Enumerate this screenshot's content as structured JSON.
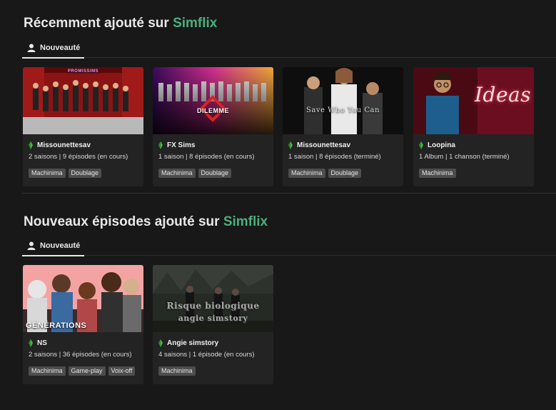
{
  "sections": [
    {
      "title_prefix": "Récemment ajouté sur ",
      "title_brand": "Simflix",
      "tab_label": "Nouveauté",
      "cards": [
        {
          "author": "Missounettesav",
          "meta": "2 saisons | 9 épisodes (en cours)",
          "tags": [
            "Machinima",
            "Doublage"
          ],
          "thumb_text": "PROMISSIMS"
        },
        {
          "author": "FX Sims",
          "meta": "1 saison | 8 épisodes (en cours)",
          "tags": [
            "Machinima",
            "Doublage"
          ],
          "thumb_text": "DILEMME"
        },
        {
          "author": "Missounettesav",
          "meta": "1 saison | 8 épisodes (terminé)",
          "tags": [
            "Machinima",
            "Doublage"
          ],
          "thumb_text": "Save Who You Can"
        },
        {
          "author": "Loopina",
          "meta": "1 Album | 1 chanson (terminé)",
          "tags": [
            "Machinima"
          ],
          "thumb_text": "Ideas"
        }
      ]
    },
    {
      "title_prefix": "Nouveaux épisodes ajouté sur ",
      "title_brand": "Simflix",
      "tab_label": "Nouveauté",
      "cards": [
        {
          "author": "NS",
          "meta": "2 saisons | 36 épisodes (en cours)",
          "tags": [
            "Machinima",
            "Game-play",
            "Voix-off"
          ],
          "thumb_text": "GÉNÉRATIONS"
        },
        {
          "author": "Angie simstory",
          "meta": "4 saisons | 1 épisode (en cours)",
          "tags": [
            "Machinima"
          ],
          "thumb_text_line1": "Risque biologique",
          "thumb_text_line2": "angie simstory"
        }
      ]
    }
  ],
  "colors": {
    "background": "#181818",
    "card": "#232323",
    "brand": "#4caf7d",
    "tag": "#4d4d4d",
    "plumbob": "#3fbf3f"
  },
  "icons": {
    "tab": "user-icon",
    "author": "plumbob-icon"
  }
}
